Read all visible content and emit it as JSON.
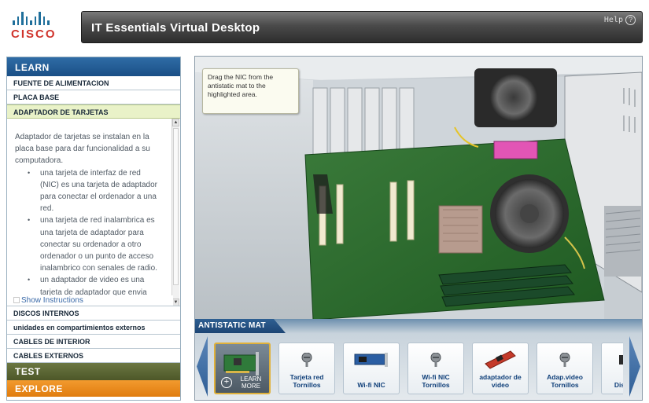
{
  "header": {
    "logo_text": "CISCO",
    "title": "IT Essentials Virtual Desktop",
    "help_label": "Help",
    "help_icon": "?"
  },
  "sidebar": {
    "learn_label": "LEARN",
    "items_top": [
      {
        "label": "FUENTE DE ALIMENTACION"
      },
      {
        "label": "PLACA BASE"
      },
      {
        "label": "ADAPTADOR DE TARJETAS"
      }
    ],
    "content": {
      "intro": "Adaptador de tarjetas se instalan en la placa base para dar funcionalidad a su computadora.",
      "bullets": [
        "una tarjeta de interfaz de red (NIC) es una tarjeta de adaptador para conectar el ordenador a una red.",
        "una tarjeta de red inalambrica es una tarjeta de adaptador para conectar su ordenador a otro ordenador o un punto de acceso inalambrico con senales de radio.",
        "un adaptador de video es una tarjeta de adaptador que envia"
      ],
      "show_instructions": "Show Instructions"
    },
    "items_bottom": [
      {
        "label": "DISCOS INTERNOS"
      },
      {
        "label": "unidades en compartimientos externos"
      },
      {
        "label": "CABLES DE INTERIOR"
      },
      {
        "label": "CABLES EXTERNOS"
      }
    ],
    "test_label": "TEST",
    "explore_label": "EXPLORE"
  },
  "workspace": {
    "tooltip": "Drag the NIC from the antistatic mat to the highlighted area."
  },
  "mat": {
    "tab_label": "ANTISTATIC MAT",
    "items": [
      {
        "label": "LEARN MORE",
        "icon": "nic-card-icon"
      },
      {
        "label": "Tarjeta red Tornillos",
        "icon": "screw-icon"
      },
      {
        "label": "Wi-fi NIC",
        "icon": "wifi-card-icon"
      },
      {
        "label": "Wi-fi NIC Tornillos",
        "icon": "screw-icon"
      },
      {
        "label": "adaptador de video",
        "icon": "video-card-icon"
      },
      {
        "label": "Adap.video Tornillos",
        "icon": "screw-icon"
      },
      {
        "label": "Disc unid",
        "icon": "drive-icon"
      }
    ]
  },
  "colors": {
    "learn": "#1a4f86",
    "test": "#5a6432",
    "explore": "#e8841a",
    "link": "#3a6aa8",
    "label_blue": "#0f3f79",
    "selection": "#e0b13a"
  }
}
